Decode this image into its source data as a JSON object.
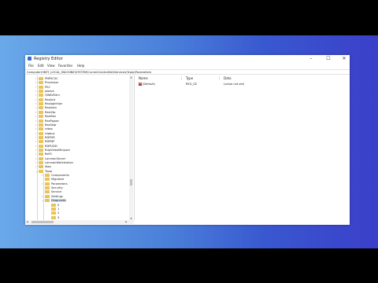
{
  "window": {
    "title": "Registry Editor",
    "minimize_glyph": "–",
    "maximize_glyph": "☐",
    "close_glyph": "✕"
  },
  "menu": [
    "File",
    "Edit",
    "View",
    "Favorites",
    "Help"
  ],
  "address": "Computer\\HKEY_LOCAL_MACHINE\\SYSTEM\\CurrentControlSet\\Services\\Tcpip\\Parameters",
  "tree": {
    "items": [
      {
        "label": "PNP0C0C",
        "indent": 0,
        "expander": "›"
      },
      {
        "label": "Processor",
        "indent": 0,
        "expander": "›"
      },
      {
        "label": "PSC",
        "indent": 0,
        "expander": "›"
      },
      {
        "label": "qwave",
        "indent": 0,
        "expander": "›"
      },
      {
        "label": "QWAVEdrv",
        "indent": 0,
        "expander": "›"
      },
      {
        "label": "RasAcd",
        "indent": 0,
        "expander": "›"
      },
      {
        "label": "RasAgileVpn",
        "indent": 0,
        "expander": "›"
      },
      {
        "label": "RasAuto",
        "indent": 0,
        "expander": "›"
      },
      {
        "label": "Rasl2tp",
        "indent": 0,
        "expander": "›"
      },
      {
        "label": "RasMan",
        "indent": 0,
        "expander": "›"
      },
      {
        "label": "RasPppoe",
        "indent": 0,
        "expander": "›"
      },
      {
        "label": "RasSstp",
        "indent": 0,
        "expander": "›"
      },
      {
        "label": "rdbss",
        "indent": 0,
        "expander": "›"
      },
      {
        "label": "rdpbus",
        "indent": 0,
        "expander": "›"
      },
      {
        "label": "RDPDR",
        "indent": 0,
        "expander": "›"
      },
      {
        "label": "RDPNP",
        "indent": 0,
        "expander": "›"
      },
      {
        "label": "RDPUDD",
        "indent": 0,
        "expander": "›"
      },
      {
        "label": "RdpVideoMiniport",
        "indent": 0,
        "expander": "›"
      },
      {
        "label": "ReFS",
        "indent": 0,
        "expander": "›"
      },
      {
        "label": "LanmanServer",
        "indent": 0,
        "expander": "›"
      },
      {
        "label": "LanmanWorkstation",
        "indent": 0,
        "expander": "›"
      },
      {
        "label": "ldap",
        "indent": 0,
        "expander": "›"
      },
      {
        "label": "Tcpip",
        "indent": 0,
        "expander": "⌄"
      },
      {
        "label": "Components",
        "indent": 1,
        "expander": "›"
      },
      {
        "label": "Migrated",
        "indent": 1,
        "expander": ""
      },
      {
        "label": "Parameters",
        "indent": 1,
        "expander": "›"
      },
      {
        "label": "Security",
        "indent": 1,
        "expander": ""
      },
      {
        "label": "Service",
        "indent": 1,
        "expander": ""
      },
      {
        "label": "Settings",
        "indent": 1,
        "expander": "›"
      },
      {
        "label": "Diagnostic",
        "indent": 1,
        "expander": "⌄",
        "selected": true
      },
      {
        "label": "0",
        "indent": 2,
        "expander": ""
      },
      {
        "label": "1",
        "indent": 2,
        "expander": ""
      },
      {
        "label": "2",
        "indent": 2,
        "expander": ""
      },
      {
        "label": "3",
        "indent": 2,
        "expander": ""
      }
    ]
  },
  "values": {
    "columns": [
      "Name",
      "Type",
      "Data"
    ],
    "rows": [
      {
        "icon": "ab",
        "name": "(Default)",
        "type": "REG_SZ",
        "data": "(value not set)"
      }
    ]
  },
  "colors": {
    "desktop_left": "#6aa9e9",
    "desktop_right": "#3b3fc9",
    "folder": "#e9c45a",
    "selection": "#cce4f7"
  }
}
